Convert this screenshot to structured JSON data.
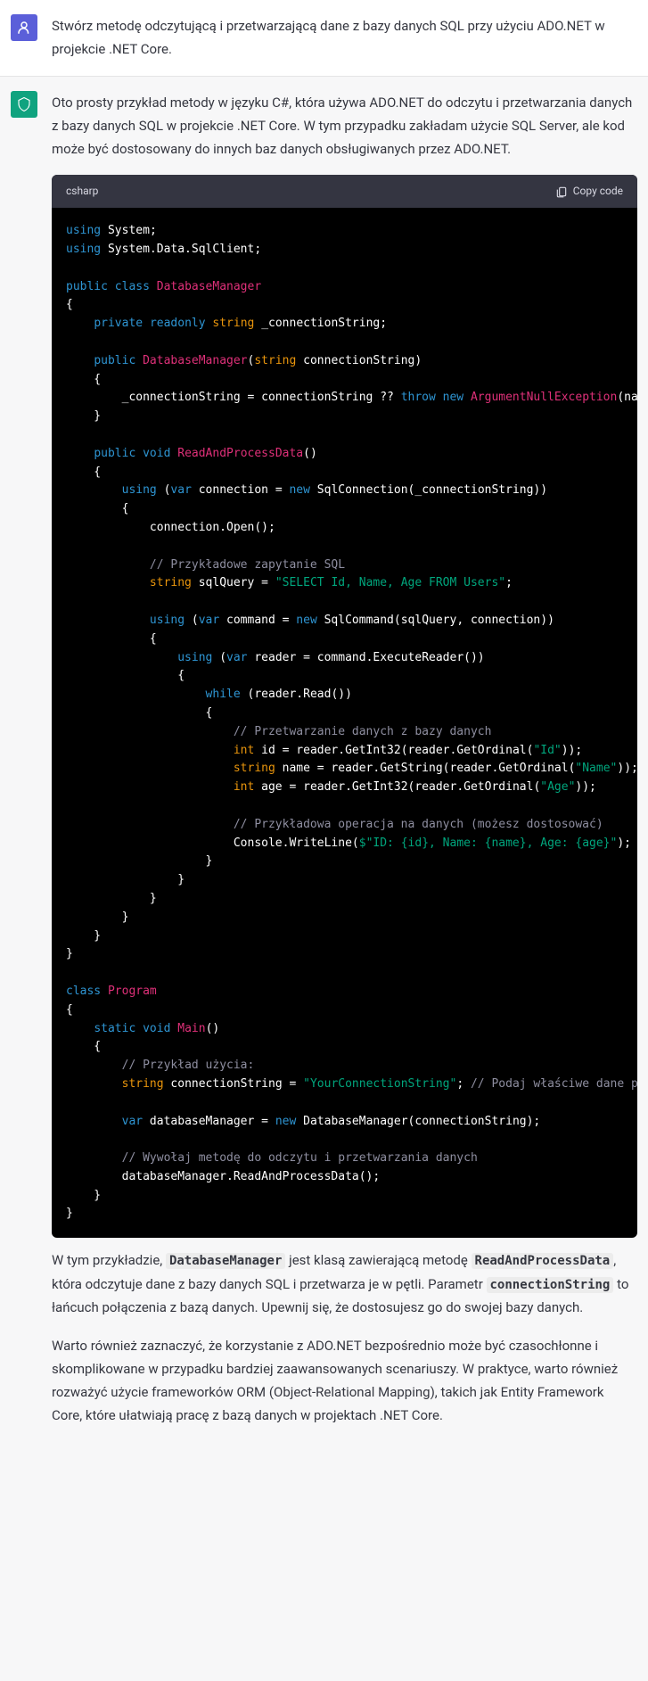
{
  "user_message": "Stwórz metodę odczytującą i przetwarzającą dane z bazy danych SQL przy użyciu ADO.NET w projekcie .NET Core.",
  "assistant_intro": "Oto prosty przykład metody w języku C#, która używa ADO.NET do odczytu i przetwarzania danych z bazy danych SQL w projekcie .NET Core. W tym przypadku zakładam użycie SQL Server, ale kod może być dostosowany do innych baz danych obsługiwanych przez ADO.NET.",
  "code_lang": "csharp",
  "copy_label": "Copy code",
  "code": {
    "using1": "using",
    "system": "System",
    "using2": "using",
    "sqlclient": "System.Data.SqlClient",
    "public": "public",
    "class": "class",
    "dbmanager": "DatabaseManager",
    "private": "private",
    "readonly": "readonly",
    "string": "string",
    "connstr_field": "_connectionString",
    "ctor_name": "DatabaseManager",
    "ctor_param": "connectionString",
    "throw": "throw",
    "new": "new",
    "argnull": "ArgumentNullException",
    "void": "void",
    "readmethod": "ReadAndProcessData",
    "var": "var",
    "sqlconn": "SqlConnection",
    "open": "Open",
    "cmt_query": "// Przykładowe zapytanie SQL",
    "sqlquery_var": "sqlQuery",
    "sqlquery_str": "\"SELECT Id, Name, Age FROM Users\"",
    "sqlcmd": "SqlCommand",
    "execreader": "ExecuteReader",
    "while": "while",
    "read": "Read",
    "cmt_process": "// Przetwarzanie danych z bazy danych",
    "int": "int",
    "getint32": "GetInt32",
    "getordinal": "GetOrdinal",
    "id_str": "\"Id\"",
    "getstring": "GetString",
    "name_str": "\"Name\"",
    "age_str": "\"Age\"",
    "cmt_op": "// Przykładowa operacja na danych (możesz dostosować)",
    "console": "Console",
    "writeline": "WriteLine",
    "interp": "$\"ID: {id}, Name: {name}, Age: {age}\"",
    "program": "Program",
    "static": "static",
    "main": "Main",
    "cmt_usage": "// Przykład użycia:",
    "yourconn": "\"YourConnectionString\"",
    "cmt_conn": "// Podaj właściwe dane połączeniowe",
    "cmt_call": "// Wywołaj metodę do odczytu i przetwarzania danych"
  },
  "outro": {
    "p1_pre": "W tym przykładzie, ",
    "p1_code1": "DatabaseManager",
    "p1_mid1": " jest klasą zawierającą metodę ",
    "p1_code2": "ReadAndProcessData",
    "p1_mid2": ", która odczytuje dane z bazy danych SQL i przetwarza je w pętli. Parametr ",
    "p1_code3": "connectionString",
    "p1_post": " to łańcuch połączenia z bazą danych. Upewnij się, że dostosujesz go do swojej bazy danych.",
    "p2": "Warto również zaznaczyć, że korzystanie z ADO.NET bezpośrednio może być czasochłonne i skomplikowane w przypadku bardziej zaawansowanych scenariuszy. W praktyce, warto również rozważyć użycie frameworków ORM (Object-Relational Mapping), takich jak Entity Framework Core, które ułatwiają pracę z bazą danych w projektach .NET Core."
  }
}
